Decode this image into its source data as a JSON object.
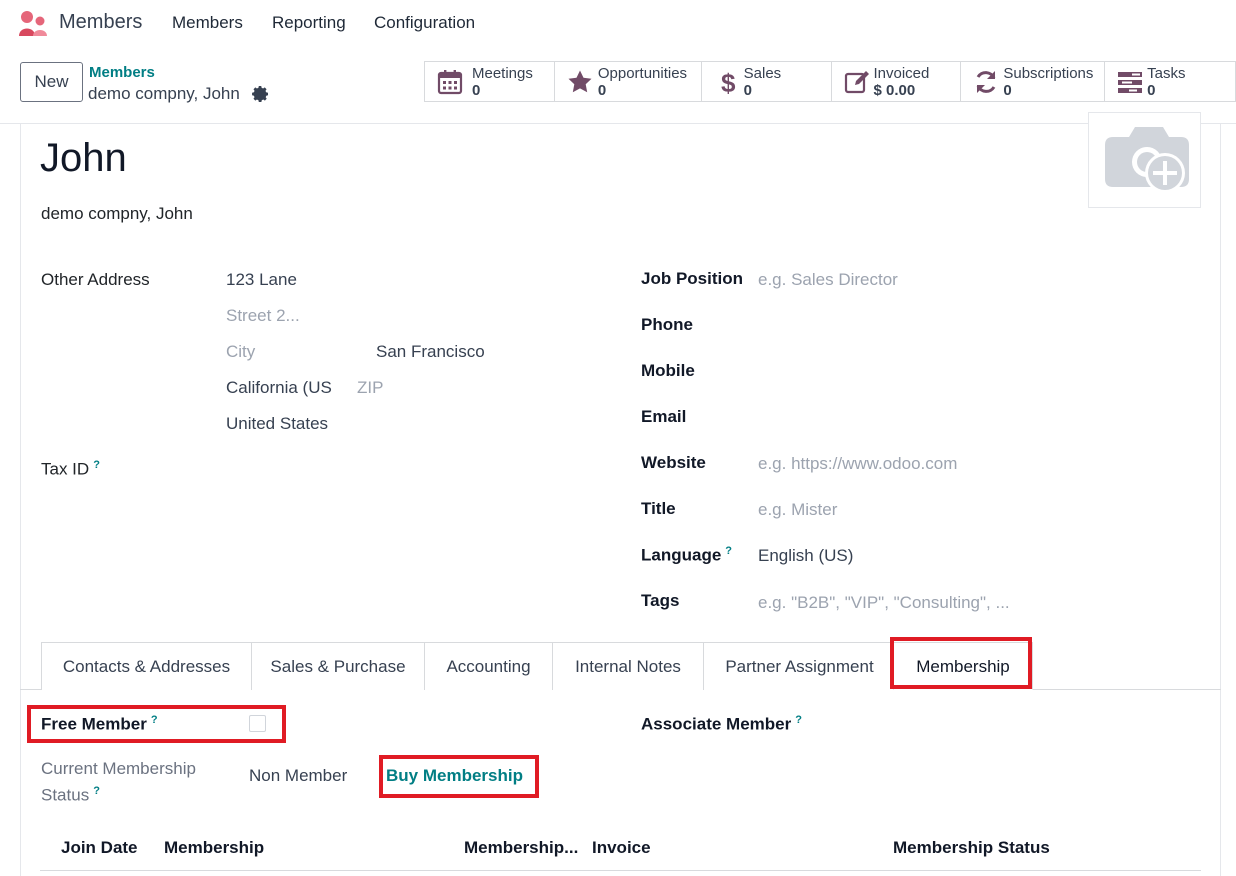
{
  "app": {
    "name": "Members",
    "menu": [
      "Members",
      "Reporting",
      "Configuration"
    ]
  },
  "control_panel": {
    "new_label": "New",
    "breadcrumb_parent": "Members",
    "breadcrumb_current": "demo compny, John"
  },
  "stat_buttons": [
    {
      "label": "Meetings",
      "value": "0",
      "icon": "calendar-icon"
    },
    {
      "label": "Opportunities",
      "value": "0",
      "icon": "star-icon"
    },
    {
      "label": "Sales",
      "value": "0",
      "icon": "dollar-icon"
    },
    {
      "label": "Invoiced",
      "value": "$ 0.00",
      "icon": "edit-icon"
    },
    {
      "label": "Subscriptions",
      "value": "0",
      "icon": "refresh-icon"
    },
    {
      "label": "Tasks",
      "value": "0",
      "icon": "tasks-icon"
    }
  ],
  "record": {
    "name": "John",
    "company_line": "demo compny, John"
  },
  "address": {
    "label": "Other Address",
    "street": "123 Lane",
    "street2_placeholder": "Street 2...",
    "city_placeholder": "City",
    "city": "San Francisco",
    "state": "California (US",
    "zip_placeholder": "ZIP",
    "country": "United States"
  },
  "tax_id": {
    "label": "Tax ID",
    "help": "?"
  },
  "right_fields": [
    {
      "label": "Job Position",
      "placeholder": "e.g. Sales Director",
      "value": ""
    },
    {
      "label": "Phone",
      "placeholder": "",
      "value": ""
    },
    {
      "label": "Mobile",
      "placeholder": "",
      "value": ""
    },
    {
      "label": "Email",
      "placeholder": "",
      "value": ""
    },
    {
      "label": "Website",
      "placeholder": "e.g. https://www.odoo.com",
      "value": ""
    },
    {
      "label": "Title",
      "placeholder": "e.g. Mister",
      "value": ""
    },
    {
      "label": "Language",
      "placeholder": "",
      "value": "English (US)",
      "help": "?"
    },
    {
      "label": "Tags",
      "placeholder": "e.g. \"B2B\", \"VIP\", \"Consulting\", ...",
      "value": ""
    }
  ],
  "tabs": [
    "Contacts & Addresses",
    "Sales & Purchase",
    "Accounting",
    "Internal Notes",
    "Partner Assignment",
    "Membership"
  ],
  "active_tab": "Membership",
  "membership": {
    "free_member_label": "Free Member",
    "free_member_checked": false,
    "associate_member_label": "Associate Member",
    "current_status_label_line1": "Current Membership",
    "current_status_label_line2": "Status",
    "current_status_value": "Non Member",
    "buy_label": "Buy Membership",
    "help": "?"
  },
  "membership_table": {
    "columns": [
      "Join Date",
      "Membership",
      "Membership...",
      "Invoice",
      "Membership Status"
    ]
  },
  "colors": {
    "accent_teal": "#017e84",
    "brand_plum": "#714b67",
    "highlight_red": "#e01b24"
  }
}
